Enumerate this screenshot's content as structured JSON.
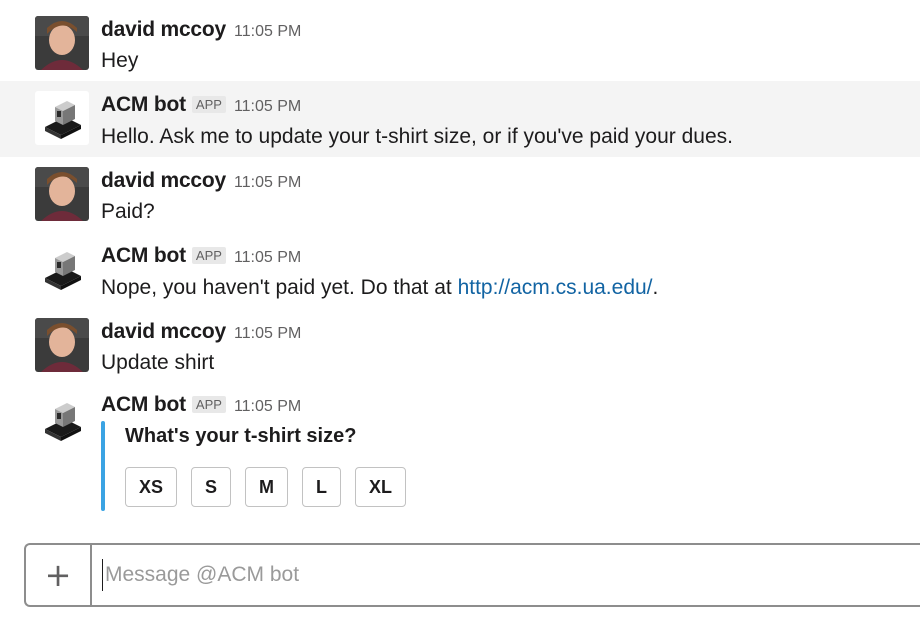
{
  "messages": [
    {
      "sender": "david mccoy",
      "time": "11:05 PM",
      "text": "Hey"
    },
    {
      "sender": "ACM bot",
      "badge": "APP",
      "time": "11:05 PM",
      "text": "Hello. Ask me to update your t-shirt size, or if you've paid your dues."
    },
    {
      "sender": "david mccoy",
      "time": "11:05 PM",
      "text": "Paid?"
    },
    {
      "sender": "ACM bot",
      "badge": "APP",
      "time": "11:05 PM",
      "text_before": "Nope, you haven't paid yet. Do that at ",
      "link": "http://acm.cs.ua.edu/",
      "text_after": "."
    },
    {
      "sender": "david mccoy",
      "time": "11:05 PM",
      "text": "Update shirt"
    },
    {
      "sender": "ACM bot",
      "badge": "APP",
      "time": "11:05 PM"
    }
  ],
  "attachment": {
    "title": "What's your t-shirt size?",
    "buttons": [
      "XS",
      "S",
      "M",
      "L",
      "XL"
    ],
    "accent_color": "#3aa3e3"
  },
  "composer": {
    "plus_label": "+",
    "placeholder": "Message @ACM bot"
  }
}
